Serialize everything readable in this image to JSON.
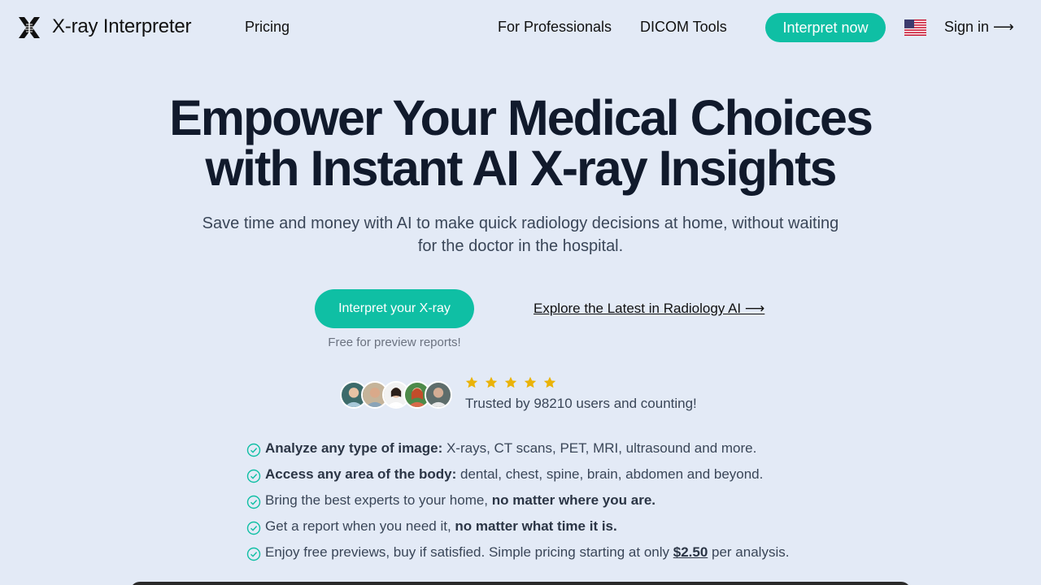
{
  "nav": {
    "brand": "X-ray Interpreter",
    "pricing": "Pricing",
    "for_professionals": "For Professionals",
    "dicom_tools": "DICOM Tools",
    "cta": "Interpret now",
    "flag_icon": "us-flag-icon",
    "sign_in": "Sign in ⟶"
  },
  "hero": {
    "headline_line1": "Empower Your Medical Choices",
    "headline_line2": "with Instant AI X-ray Insights",
    "subtitle": "Save time and money with AI to make quick radiology decisions at home, without waiting for the doctor in the hospital.",
    "cta": "Interpret your X-ray",
    "cta_note": "Free for preview reports!",
    "explore_link": "Explore the Latest in Radiology AI ⟶"
  },
  "trust": {
    "rating": 5,
    "rating_max": 5,
    "text": "Trusted by 98210 users and counting!",
    "star_color": "#eab308"
  },
  "features": [
    {
      "bold": "Analyze any type of image:",
      "rest": " X-rays, CT scans, PET, MRI, ultrasound and more."
    },
    {
      "bold": "Access any area of the body:",
      "rest": " dental, chest, spine, brain, abdomen and beyond."
    },
    {
      "pre": "Bring the best experts to your home,",
      "bold2": " no matter where you are."
    },
    {
      "pre": "Get a report when you need it,",
      "bold2": " no matter what time it is."
    },
    {
      "pre": "Enjoy free previews, buy if satisfied. Simple pricing starting at only ",
      "price": "$2.50",
      "post": " per analysis."
    }
  ],
  "colors": {
    "background": "#e3eaf6",
    "accent": "#0fbfa4",
    "heading": "#111a2c",
    "body_text": "#3a4658"
  }
}
